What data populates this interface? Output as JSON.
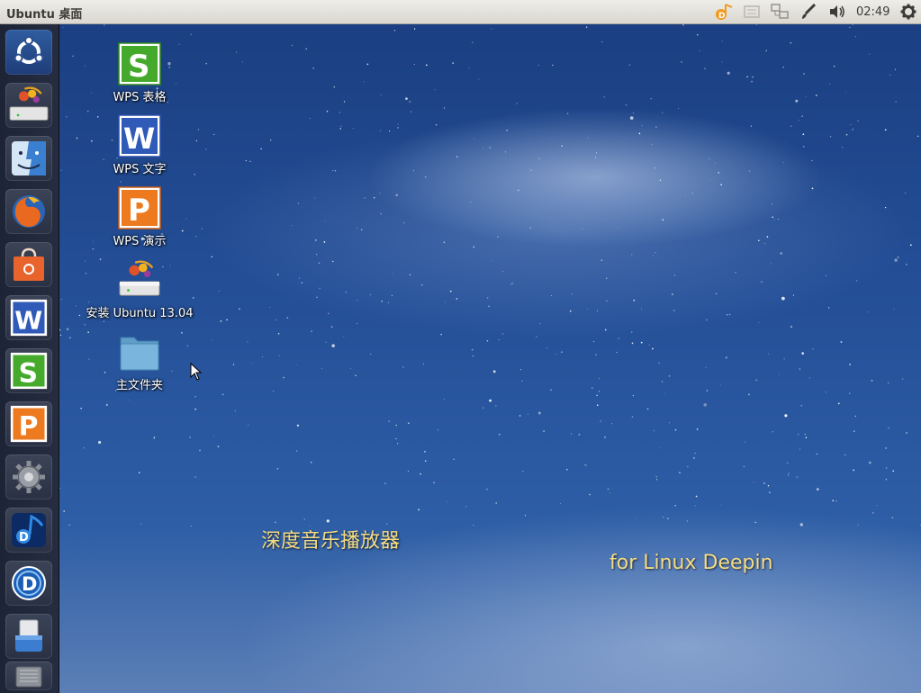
{
  "top_panel": {
    "title": "Ubuntu 桌面",
    "clock": "02:49",
    "tray_icons": [
      "deepin-music-tray-icon",
      "keyboard-icon",
      "network-icon",
      "brush-icon",
      "volume-icon",
      "gear-icon"
    ]
  },
  "launcher": {
    "items": [
      {
        "name": "ubuntu-dash",
        "icon": "ubuntu-logo-icon"
      },
      {
        "name": "install-ubuntu",
        "icon": "install-drive-icon"
      },
      {
        "name": "files",
        "icon": "finder-face-icon"
      },
      {
        "name": "firefox",
        "icon": "firefox-icon"
      },
      {
        "name": "software-center",
        "icon": "shopping-bag-icon"
      },
      {
        "name": "wps-writer",
        "icon": "wps-w-icon"
      },
      {
        "name": "wps-spreadsheets",
        "icon": "wps-s-icon"
      },
      {
        "name": "wps-presentation",
        "icon": "wps-p-icon"
      },
      {
        "name": "system-settings",
        "icon": "gear-icon"
      },
      {
        "name": "deepin-music",
        "icon": "music-note-icon"
      },
      {
        "name": "deepin-software",
        "icon": "deepin-d-icon"
      },
      {
        "name": "removable-drive",
        "icon": "usb-drive-icon"
      },
      {
        "name": "trash",
        "icon": "trash-icon"
      }
    ]
  },
  "desktop": {
    "icons": [
      {
        "label": "WPS 表格",
        "icon": "wps-s-icon"
      },
      {
        "label": "WPS 文字",
        "icon": "wps-w-icon"
      },
      {
        "label": "WPS 演示",
        "icon": "wps-p-icon"
      },
      {
        "label": "安装 Ubuntu 13.04",
        "icon": "install-drive-icon"
      },
      {
        "label": "主文件夹",
        "icon": "folder-icon"
      }
    ],
    "wallpaper_text_1": "深度音乐播放器",
    "wallpaper_text_2": "for Linux Deepin"
  },
  "colors": {
    "panel": "#dfddd6",
    "launcher": "#232a3c",
    "wallpaper": "#244f97",
    "promo_text": "#f6dc82",
    "wps_s": "#3fa52a",
    "wps_w": "#2c55b6",
    "wps_p": "#e8731c"
  }
}
